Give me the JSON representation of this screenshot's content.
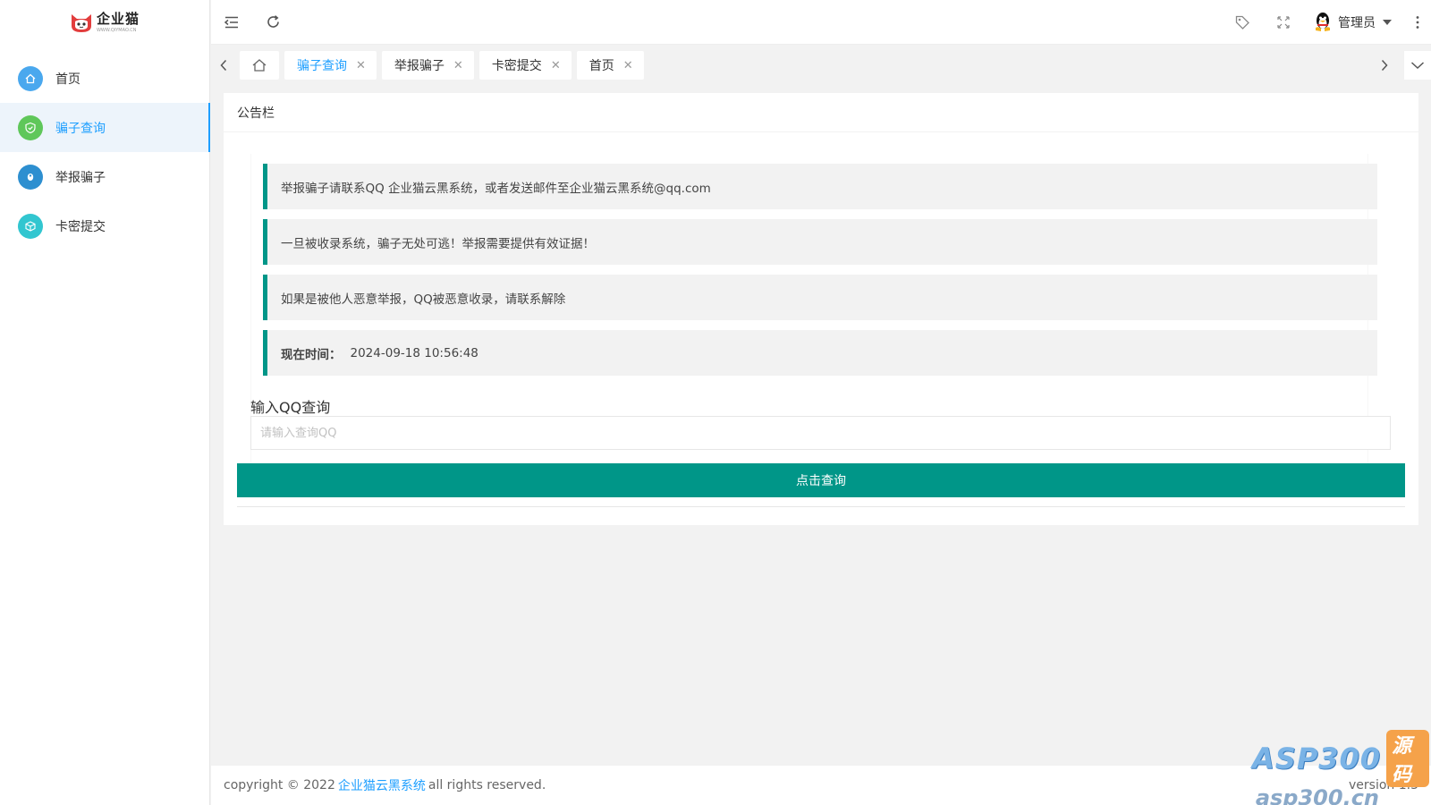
{
  "brand": {
    "name": "企业猫",
    "subtitle": "WWW.QIYMAO.CN"
  },
  "sidebar": {
    "items": [
      {
        "label": "首页",
        "icon": "home-icon",
        "color": "#4aa8ee",
        "active": false
      },
      {
        "label": "骗子查询",
        "icon": "shield-check-icon",
        "color": "#5fc75a",
        "active": true
      },
      {
        "label": "举报骗子",
        "icon": "user-icon",
        "color": "#2d8fd0",
        "active": false
      },
      {
        "label": "卡密提交",
        "icon": "cube-icon",
        "color": "#32c6d0",
        "active": false
      }
    ]
  },
  "header": {
    "user_name": "管理员"
  },
  "tabs": [
    {
      "label": "骗子查询",
      "active": true
    },
    {
      "label": "举报骗子",
      "active": false
    },
    {
      "label": "卡密提交",
      "active": false
    },
    {
      "label": "首页",
      "active": false
    }
  ],
  "card": {
    "title": "公告栏",
    "notices": [
      "举报骗子请联系QQ 企业猫云黑系统，或者发送邮件至企业猫云黑系统@qq.com",
      "一旦被收录系统，骗子无处可逃！举报需要提供有效证据！",
      "如果是被他人恶意举报，QQ被恶意收录，请联系解除"
    ],
    "time_label": "现在时间：",
    "time_value": "2024-09-18 10:56:48",
    "query_label": "输入QQ查询",
    "query_placeholder": "请输入查询QQ",
    "query_value": "",
    "query_button": "点击查询"
  },
  "footer": {
    "prefix": "copyright © 2022",
    "link": "企业猫云黑系统",
    "suffix": "all rights reserved.",
    "version": "version 1.3"
  },
  "watermark": {
    "brand": "ASP300",
    "tag": "源码",
    "url": "asp300.cn"
  },
  "colors": {
    "accent": "#009688",
    "link": "#1e9fff",
    "active_bg": "#edf4fb"
  }
}
